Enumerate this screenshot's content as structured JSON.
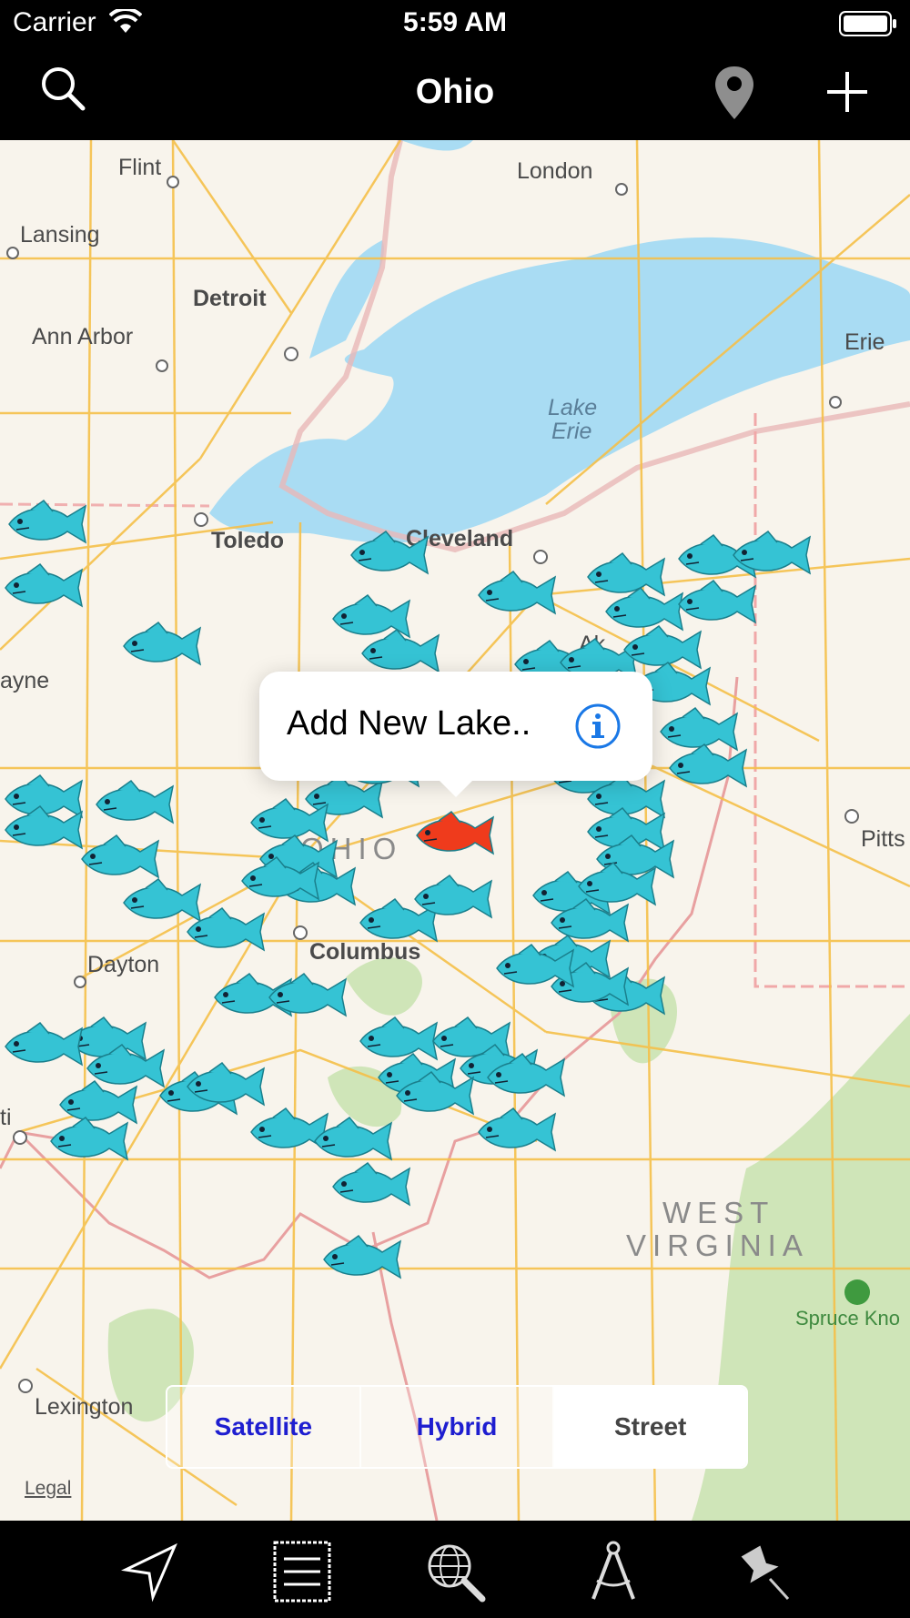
{
  "status": {
    "carrier": "Carrier",
    "time": "5:59 AM"
  },
  "nav": {
    "title": "Ohio",
    "icons": [
      "search-icon",
      "pin-icon",
      "plus-icon"
    ]
  },
  "callout": {
    "label": "Add New Lake..",
    "icon": "info-icon"
  },
  "map": {
    "cities": {
      "flint": "Flint",
      "lansing": "Lansing",
      "london": "London",
      "detroit": "Detroit",
      "ann_arbor": "Ann Arbor",
      "erie": "Erie",
      "lake_erie_1": "Lake",
      "lake_erie_2": "Erie",
      "toledo": "Toledo",
      "cleveland": "Cleveland",
      "wayne": "ayne",
      "ak": "Ak",
      "pitts": "Pitts",
      "columbus": "Columbus",
      "dayton": "Dayton",
      "ti": "ti",
      "spruce": "Spruce Kno",
      "lexington": "Lexington"
    },
    "regions": {
      "ohio": "OHIO",
      "wv1": "WEST",
      "wv2": "VIRGINIA"
    },
    "legal": "Legal",
    "colors": {
      "land": "#f8f4ec",
      "water": "#a9dcf3",
      "road": "#f5c04a",
      "park": "#cfe5b8",
      "fish": "#35c3d4",
      "selected_fish": "#ef3b1c"
    }
  },
  "segments": {
    "satellite": "Satellite",
    "hybrid": "Hybrid",
    "street": "Street",
    "selected": "Street"
  },
  "tabs": [
    "location-arrow-icon",
    "list-icon",
    "globe-search-icon",
    "compass-tool-icon",
    "pushpin-icon"
  ]
}
